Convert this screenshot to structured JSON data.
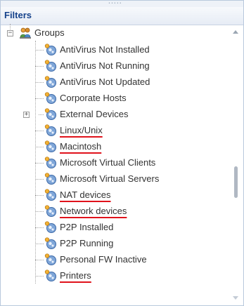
{
  "panel": {
    "title": "Filters",
    "grip": "•••••"
  },
  "tree": {
    "root": {
      "label": "Groups",
      "icon": "group-folder-icon",
      "toggle": "−"
    },
    "items": [
      {
        "label": "AntiVirus Not Installed",
        "icon": "group-node-icon",
        "underlined": false
      },
      {
        "label": "AntiVirus Not Running",
        "icon": "group-node-icon",
        "underlined": false
      },
      {
        "label": "AntiVirus Not Updated",
        "icon": "group-node-icon",
        "underlined": false
      },
      {
        "label": "Corporate Hosts",
        "icon": "group-node-icon",
        "underlined": false
      },
      {
        "label": "External Devices",
        "icon": "group-node-icon",
        "underlined": false,
        "toggle": "+"
      },
      {
        "label": "Linux/Unix",
        "icon": "group-node-icon",
        "underlined": true
      },
      {
        "label": "Macintosh",
        "icon": "group-node-icon",
        "underlined": true
      },
      {
        "label": "Microsoft Virtual Clients",
        "icon": "group-node-icon",
        "underlined": false
      },
      {
        "label": "Microsoft Virtual Servers",
        "icon": "group-node-icon",
        "underlined": false
      },
      {
        "label": "NAT devices",
        "icon": "group-node-icon",
        "underlined": true
      },
      {
        "label": "Network devices",
        "icon": "group-node-icon",
        "underlined": true
      },
      {
        "label": "P2P Installed",
        "icon": "group-node-icon",
        "underlined": false
      },
      {
        "label": "P2P Running",
        "icon": "group-node-icon",
        "underlined": false
      },
      {
        "label": "Personal FW Inactive",
        "icon": "group-node-icon",
        "underlined": false
      },
      {
        "label": "Printers",
        "icon": "group-node-icon",
        "underlined": true
      }
    ]
  },
  "colors": {
    "header_text": "#15428b",
    "highlight_underline": "#e0121b",
    "item_text": "#333333"
  }
}
